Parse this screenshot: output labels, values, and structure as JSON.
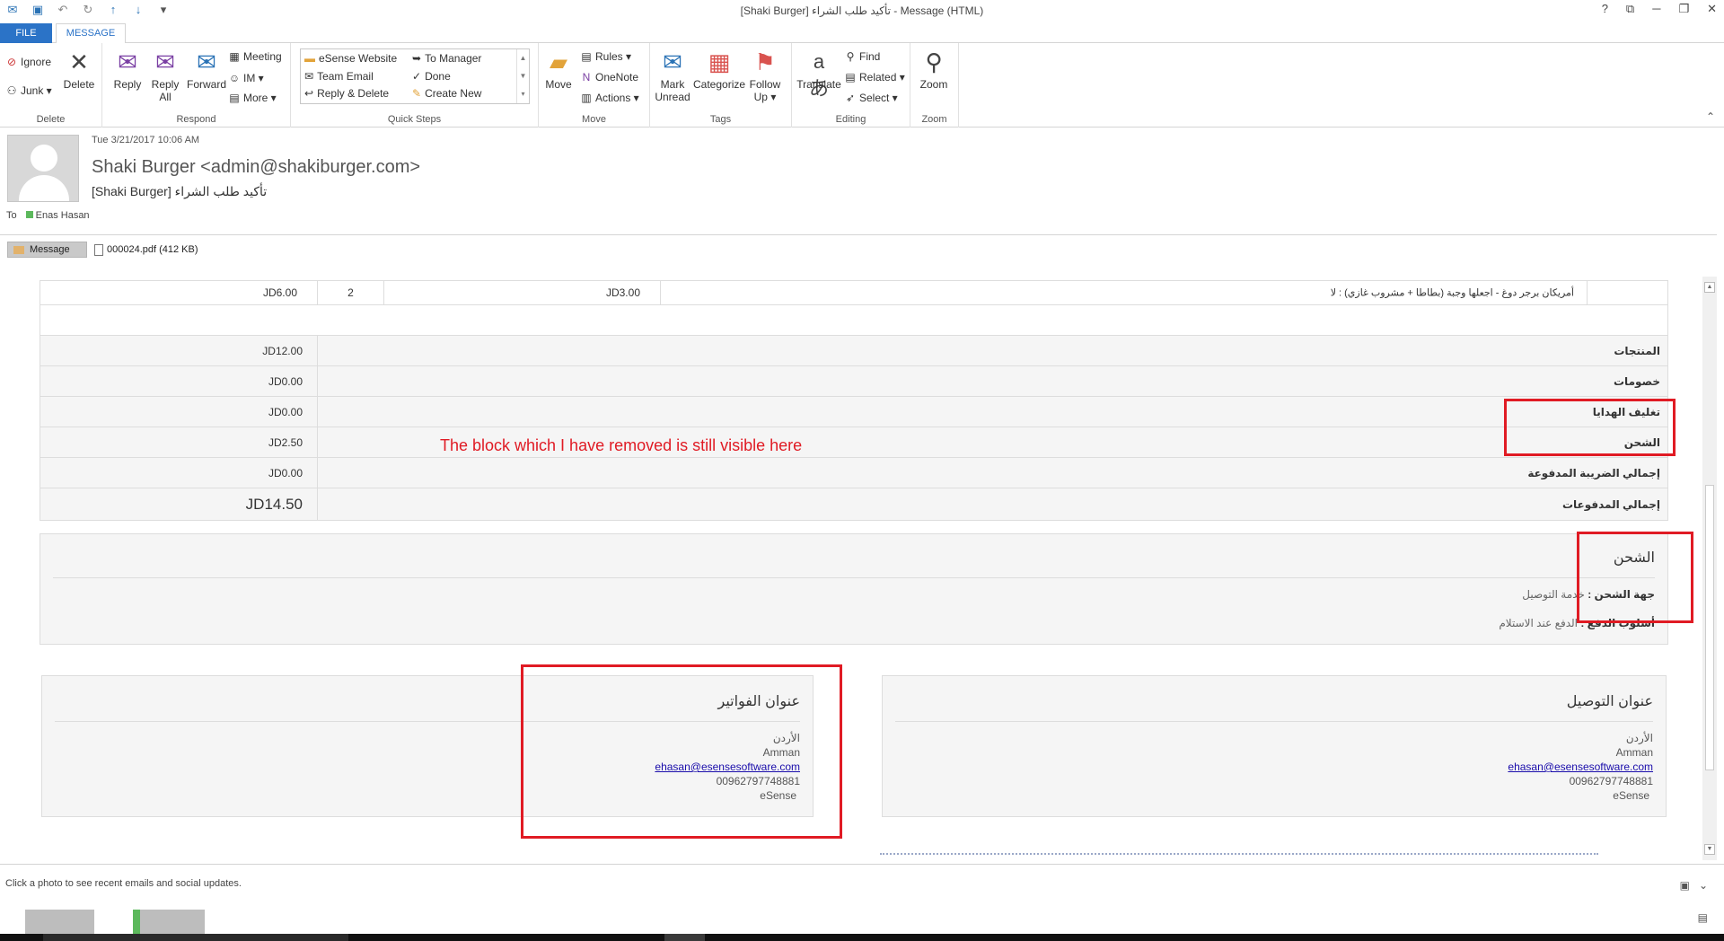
{
  "window": {
    "title": "[Shaki Burger] تأكيد طلب الشراء - Message (HTML)",
    "controls": [
      "?",
      "⧉",
      "─",
      "❐",
      "✕"
    ]
  },
  "tabs": {
    "file": "FILE",
    "message": "MESSAGE"
  },
  "ribbon": {
    "delete_group": {
      "label": "Delete",
      "ignore": "Ignore",
      "junk": "Junk ▾",
      "delete": "Delete"
    },
    "respond_group": {
      "label": "Respond",
      "reply": "Reply",
      "reply_all_1": "Reply",
      "reply_all_2": "All",
      "forward": "Forward",
      "meeting": "Meeting",
      "im": "IM ▾",
      "more": "More ▾"
    },
    "quick_steps": {
      "label": "Quick Steps",
      "items": [
        "eSense Website",
        "To Manager",
        "Team Email",
        "Done",
        "Reply & Delete",
        "Create New"
      ]
    },
    "move_group": {
      "label": "Move",
      "move": "Move",
      "rules": "Rules ▾",
      "onenote": "OneNote",
      "actions": "Actions ▾"
    },
    "tags_group": {
      "label": "Tags",
      "mark_unread_1": "Mark",
      "mark_unread_2": "Unread",
      "categorize": "Categorize",
      "follow_up_1": "Follow",
      "follow_up_2": "Up ▾"
    },
    "editing_group": {
      "label": "Editing",
      "translate": "Translate",
      "find": "Find",
      "related": "Related ▾",
      "select": "Select ▾"
    },
    "zoom_group": {
      "label": "Zoom",
      "zoom": "Zoom"
    }
  },
  "message": {
    "date": "Tue 3/21/2017 10:06 AM",
    "from": "Shaki Burger <admin@shakiburger.com>",
    "subject": "[Shaki Burger] تأكيد طلب الشراء",
    "to_label": "To",
    "to_name": "Enas Hasan",
    "attachments": {
      "message_tab": "Message",
      "pdf": "000024.pdf (412 KB)"
    }
  },
  "order": {
    "item_row": {
      "product": "أمريكان برجر دوغ - اجعلها وجبة (بطاطا + مشروب غازي) : لا",
      "unit_price": "JD3.00",
      "qty": "2",
      "total": "JD6.00"
    },
    "totals": [
      {
        "label": "المنتجات",
        "value": "JD12.00"
      },
      {
        "label": "خصومات",
        "value": "JD0.00"
      },
      {
        "label": "تغليف الهدايا",
        "value": "JD0.00"
      },
      {
        "label": "الشحن",
        "value": "JD2.50"
      },
      {
        "label": "إجمالي الضريبة المدفوعة",
        "value": "JD0.00"
      },
      {
        "label": "إجمالي المدفوعات",
        "value": "JD14.50"
      }
    ]
  },
  "shipping": {
    "title": "الشحن",
    "carrier_label": "جهة الشحن :",
    "carrier_value": "خدمة التوصيل",
    "payment_label": "أسلوب الدفع :",
    "payment_value": "الدفع عند الاستلام"
  },
  "billing_address": {
    "title": "عنوان الفواتير",
    "lines": [
      "الأردن",
      "Amman"
    ],
    "email": "ehasan@esensesoftware.com",
    "phone": "00962797748881",
    "company": "eSense"
  },
  "delivery_address": {
    "title": "عنوان التوصيل",
    "lines": [
      "الأردن",
      "Amman"
    ],
    "email": "ehasan@esensesoftware.com",
    "phone": "00962797748881",
    "company": "eSense"
  },
  "annotation": {
    "text": "The block which I have removed is still visible here",
    "color": "#e01b24"
  },
  "people_pane": {
    "hint": "Click a photo to see recent emails and social updates."
  }
}
